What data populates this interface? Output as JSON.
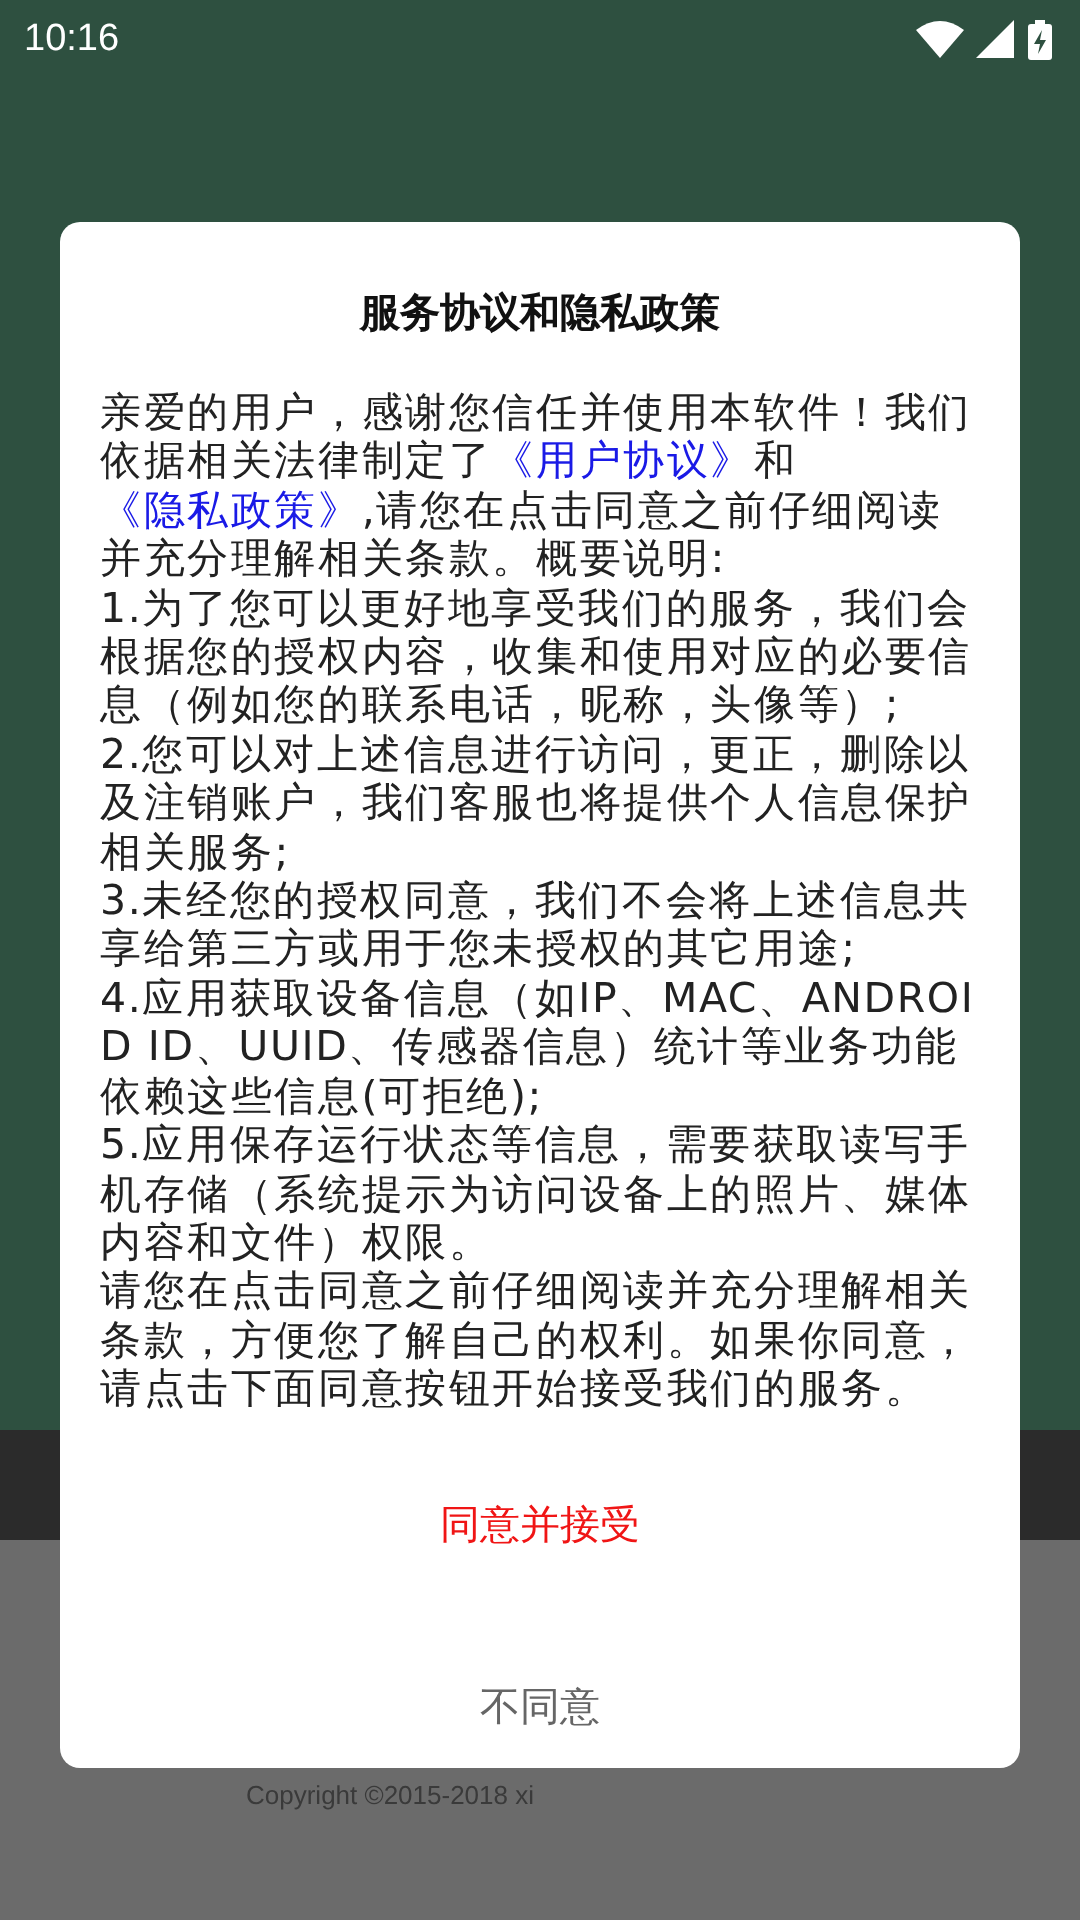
{
  "status_bar": {
    "time": "10:16"
  },
  "background": {
    "copyright": "Copyright ©2015-2018 xi"
  },
  "dialog": {
    "title": "服务协议和隐私政策",
    "intro": [
      {
        "kind": "text",
        "text": "亲爱的用户，感谢您信任并使用本软件！我们依据相关法律制定了"
      },
      {
        "kind": "link",
        "text": "《用户协议》"
      },
      {
        "kind": "text",
        "text": "和"
      },
      {
        "kind": "link",
        "text": "《隐私政策》"
      },
      {
        "kind": "text",
        "text": ",请您在点击同意之前仔细阅读并充分理解相关条款。概要说明:"
      }
    ],
    "items": [
      "1.为了您可以更好地享受我们的服务，我们会根据您的授权内容，收集和使用对应的必要信息（例如您的联系电话，昵称，头像等）;",
      "2.您可以对上述信息进行访问，更正，删除以及注销账户，我们客服也将提供个人信息保护相关服务;",
      "3.未经您的授权同意，我们不会将上述信息共享给第三方或用于您未授权的其它用途;",
      "4.应用获取设备信息（如IP、MAC、ANDROID ID、UUID、传感器信息）统计等业务功能依赖这些信息(可拒绝);",
      "5.应用保存运行状态等信息，需要获取读写手机存储（系统提示为访问设备上的照片、媒体内容和文件）权限。"
    ],
    "closing": "请您在点击同意之前仔细阅读并充分理解相关条款，方便您了解自己的权利。如果你同意，请点击下面同意按钮开始接受我们的服务。",
    "buttons": [
      {
        "label": "同意并接受",
        "kind": "primary"
      },
      {
        "label": "不同意",
        "kind": "secondary"
      }
    ]
  }
}
